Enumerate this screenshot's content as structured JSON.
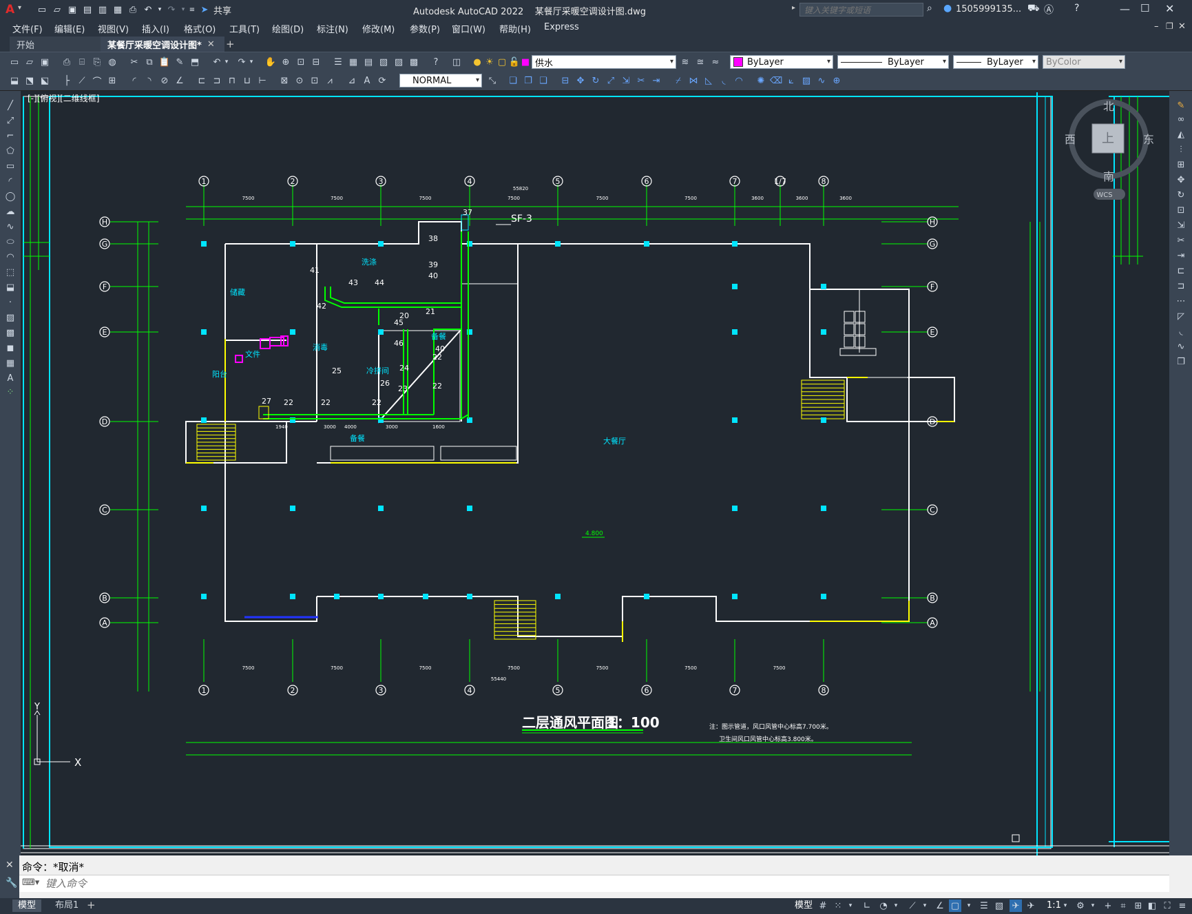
{
  "titlebar": {
    "app_title": "Autodesk AutoCAD 2022",
    "file_title": "某餐厅采暖空调设计图.dwg",
    "share_label": "共享",
    "search_placeholder": "键入关键字或短语",
    "user_name": "1505999135..."
  },
  "menu": [
    "文件(F)",
    "编辑(E)",
    "视图(V)",
    "插入(I)",
    "格式(O)",
    "工具(T)",
    "绘图(D)",
    "标注(N)",
    "修改(M)",
    "参数(P)",
    "窗口(W)",
    "帮助(H)",
    "Express"
  ],
  "tabs": [
    {
      "label": "开始"
    },
    {
      "label": "某餐厅采暖空调设计图*"
    }
  ],
  "toolbar": {
    "layer_value": "供水",
    "color_value": "ByLayer",
    "linetype_value": "ByLayer",
    "lineweight_value": "ByLayer",
    "plotstyle_value": "ByColor",
    "textstyle_value": "NORMAL"
  },
  "viewcube": {
    "north": "北",
    "south": "南",
    "east": "东",
    "west": "西",
    "top": "上",
    "wcs": "WCS"
  },
  "drawing": {
    "viewport_label": "[-][俯视][二维线框]",
    "title": "二层通风平面图",
    "scale": "1：100",
    "note1": "注：图示管道，风口风管中心标高7.700米。",
    "note2": "卫生间风口风管中心标高3.800米。",
    "elevation": "4.800",
    "grid_top": [
      "1",
      "2",
      "3",
      "4",
      "5",
      "6",
      "7",
      "1/7",
      "8"
    ],
    "grid_bottom": [
      "1",
      "2",
      "3",
      "4",
      "5",
      "6",
      "7",
      "8"
    ],
    "grid_rows": [
      "H",
      "G",
      "F",
      "E",
      "D",
      "C",
      "B",
      "A"
    ],
    "dims_top": [
      "7500",
      "7500",
      "7500",
      "7500",
      "7500",
      "7500",
      "3600",
      "3600",
      "3600"
    ],
    "dims_bottom": [
      "7500",
      "7500",
      "7500",
      "7500",
      "7500",
      "7500",
      "7500"
    ],
    "total_top": "55820",
    "total_bottom": "55440",
    "rooms": [
      "储藏",
      "洗涤",
      "消毒",
      "冷拼间",
      "备餐",
      "备餐",
      "阳台",
      "文件",
      "大餐厅"
    ],
    "equipment": "SF-3",
    "callouts": [
      "37",
      "38",
      "39",
      "40",
      "41",
      "42",
      "43",
      "44",
      "45",
      "46",
      "20",
      "21",
      "22",
      "24",
      "25",
      "26",
      "27",
      "23",
      "40",
      "22",
      "22",
      "22",
      "22"
    ],
    "duct_dims": [
      "1940",
      "3000",
      "4000",
      "3000",
      "1600"
    ]
  },
  "command": {
    "history": "命令：*取消*",
    "placeholder": "键入命令"
  },
  "status": {
    "tab_model": "模型",
    "tab_layout": "布局1",
    "model_btn": "模型",
    "scale": "1:1"
  }
}
